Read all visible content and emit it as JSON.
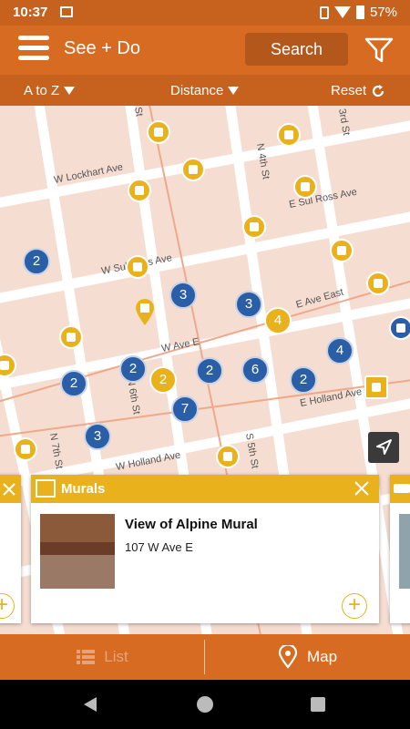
{
  "status_bar": {
    "time": "10:37",
    "battery": "57%"
  },
  "header": {
    "title": "See + Do",
    "search_label": "Search"
  },
  "sort_bar": {
    "sort_az": "A to Z",
    "sort_distance": "Distance",
    "reset": "Reset"
  },
  "map": {
    "streets": [
      "W Lockhart Ave",
      "E Sul Ross Ave",
      "W Sul Ross Ave",
      "E Ave East",
      "W Ave E",
      "E Holland Ave",
      "W Holland Ave",
      "N 4th St",
      "3rd St",
      "N 6th St",
      "N 7th St",
      "S 5th St",
      "St"
    ],
    "clusters": [
      "2",
      "3",
      "3",
      "4",
      "4",
      "2",
      "2",
      "2",
      "6",
      "2",
      "2",
      "7",
      "3"
    ],
    "poi_icons": [
      "shopping-bag-icon",
      "book-icon",
      "phone-alert-icon",
      "book-icon",
      "shoe-icon",
      "book-icon",
      "qr-code-icon",
      "phone-alert-icon",
      "dance-icon",
      "book-icon",
      "restaurant-icon",
      "book-icon",
      "book-icon",
      "mural-icon",
      "book-icon",
      "book-icon"
    ],
    "selected_pin_icon": "qr-code-icon"
  },
  "card": {
    "category": "Murals",
    "category_icon": "mural-icon",
    "place_name": "View of Alpine Mural",
    "address": "107 W Ave E"
  },
  "bottom_tabs": {
    "list": "List",
    "map": "Map",
    "active": "map"
  },
  "colors": {
    "primary": "#d76b22",
    "dark": "#c7611e",
    "accent": "#e9b21d",
    "cluster": "#2a5ea6",
    "map_bg": "#f5ddd2"
  }
}
